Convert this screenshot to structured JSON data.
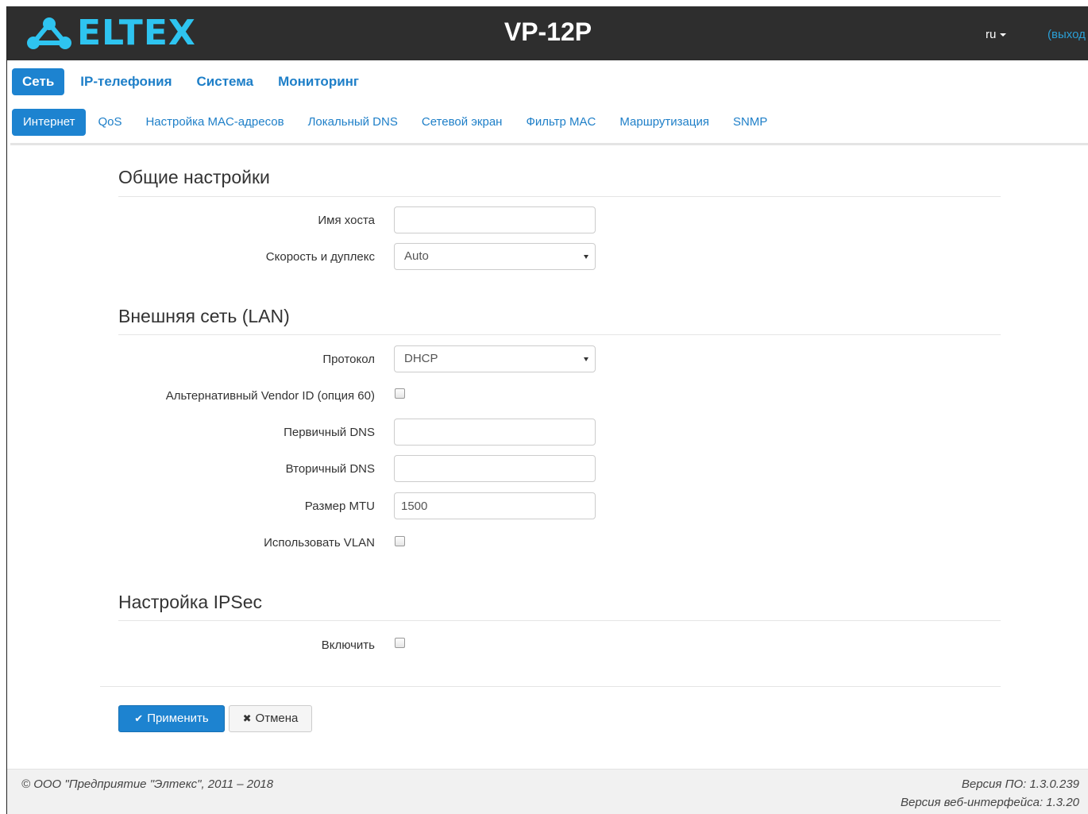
{
  "header": {
    "brand": "ELTEX",
    "device": "VP-12P",
    "lang": "ru",
    "logout": "(выход"
  },
  "main_nav": [
    {
      "label": "Сеть",
      "active": true
    },
    {
      "label": "IP-телефония",
      "active": false
    },
    {
      "label": "Система",
      "active": false
    },
    {
      "label": "Мониторинг",
      "active": false
    }
  ],
  "sub_nav": [
    {
      "label": "Интернет",
      "active": true
    },
    {
      "label": "QoS",
      "active": false
    },
    {
      "label": "Настройка MAC-адресов",
      "active": false
    },
    {
      "label": "Локальный DNS",
      "active": false
    },
    {
      "label": "Сетевой экран",
      "active": false
    },
    {
      "label": "Фильтр MAC",
      "active": false
    },
    {
      "label": "Маршрутизация",
      "active": false
    },
    {
      "label": "SNMP",
      "active": false
    }
  ],
  "general": {
    "title": "Общие настройки",
    "hostname_label": "Имя хоста",
    "hostname_value": "",
    "speed_label": "Скорость и дуплекс",
    "speed_value": "Auto"
  },
  "wan": {
    "title": "Внешняя сеть (LAN)",
    "protocol_label": "Протокол",
    "protocol_value": "DHCP",
    "vendor_label": "Альтернативный Vendor ID (опция 60)",
    "vendor_checked": false,
    "dns1_label": "Первичный DNS",
    "dns1_value": "",
    "dns2_label": "Вторичный DNS",
    "dns2_value": "",
    "mtu_label": "Размер MTU",
    "mtu_value": "1500",
    "vlan_label": "Использовать VLAN",
    "vlan_checked": false
  },
  "ipsec": {
    "title": "Настройка IPSec",
    "enable_label": "Включить",
    "enable_checked": false
  },
  "actions": {
    "apply": "Применить",
    "cancel": "Отмена"
  },
  "footer": {
    "copyright": "© ООО \"Предприятие \"Элтекс\", 2011 – 2018",
    "fw_version": "Версия ПО: 1.3.0.239",
    "web_version": "Версия веб-интерфейса: 1.3.20"
  },
  "colors": {
    "accent": "#1d83d0",
    "header_bg": "#2e2e2e",
    "logo": "#2ec4f0"
  }
}
